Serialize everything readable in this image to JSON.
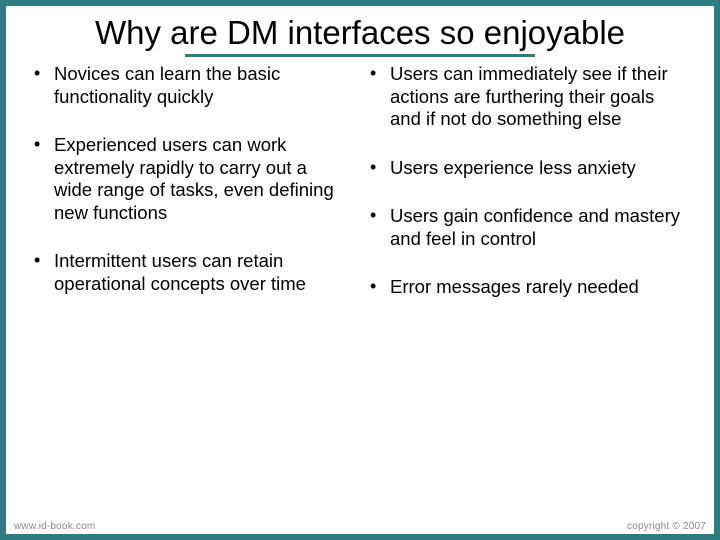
{
  "title": "Why are DM interfaces so enjoyable",
  "left_bullets": [
    "Novices can learn the basic functionality quickly",
    "Experienced users can work extremely rapidly to carry out a wide range of tasks, even defining new functions",
    "Intermittent users can retain operational concepts over time"
  ],
  "right_bullets": [
    "Users can immediately see if their actions are furthering their goals and if not do something else",
    "Users experience less anxiety",
    "Users gain confidence and mastery and feel in control",
    "Error messages rarely needed"
  ],
  "footer": {
    "left": "www.id-book.com",
    "right": "copyright © 2007"
  }
}
